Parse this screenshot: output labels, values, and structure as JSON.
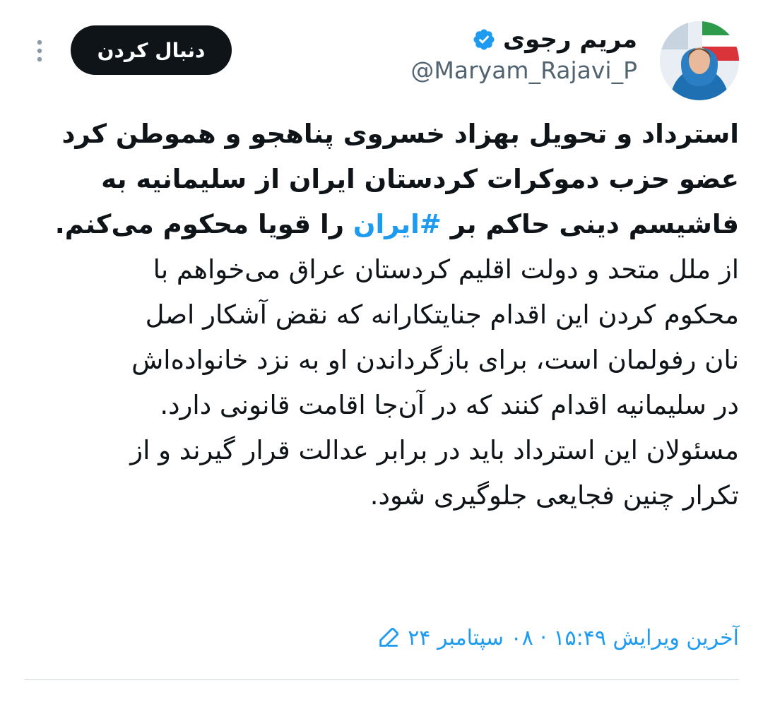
{
  "author": {
    "display_name": "مریم رجوی",
    "handle": "@Maryam_Rajavi_P",
    "verified": true
  },
  "actions": {
    "follow_label": "دنبال کردن"
  },
  "tweet": {
    "line1": "استرداد و تحویل بهزاد خسروی پناهجو و هموطن کرد",
    "line2": "عضو حزب دموکرات کردستان ایران از سلیمانیه به",
    "line3_before": "فاشیسم دینی حاکم بر ",
    "hashtag": "#ایران",
    "line3_after": " را قویا محکوم می‌کنم.",
    "line4": "از ملل متحد و دولت اقلیم کردستان عراق می‌خواهم با",
    "line5": "محکوم کردن این اقدام جنایتکارانه که نقض آشکار اصل",
    "line6": "نان رفولمان است، برای بازگرداندن او به نزد خانواده‌اش",
    "line7": "در سلیمانیه اقدام کنند که در آن‌جا اقامت قانونی دارد.",
    "line8": "مسئولان این استرداد باید در برابر عدالت قرار گیرند و از",
    "line9": "تکرار چنین فجایعی جلوگیری شود."
  },
  "edited": {
    "label": "آخرین ویرایش ۱۵:۴۹ · ۰۸ سپتامبر ۲۴"
  },
  "colors": {
    "accent": "#1d9bf0",
    "text": "#0f1419",
    "secondary": "#536471",
    "button_bg": "#0f1419"
  },
  "icons": {
    "verified": "verified-badge-icon",
    "more": "more-vertical-icon",
    "edit": "edit-pencil-icon"
  }
}
